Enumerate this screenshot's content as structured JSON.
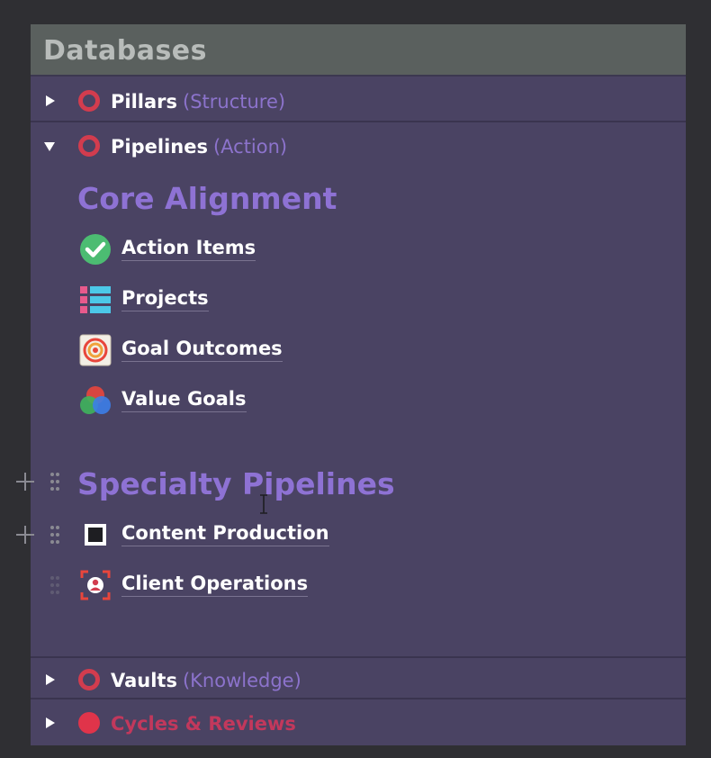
{
  "panel": {
    "title": "Databases"
  },
  "rows": {
    "pillars": {
      "label": "Pillars",
      "sub": "(Structure)",
      "state": "collapsed"
    },
    "pipelines": {
      "label": "Pipelines",
      "sub": "(Action)",
      "state": "expanded"
    },
    "vaults": {
      "label": "Vaults",
      "sub": "(Knowledge)",
      "state": "collapsed"
    },
    "cycles": {
      "label": "Cycles & Reviews",
      "state": "collapsed"
    }
  },
  "pipelines_content": {
    "core_heading": "Core Alignment",
    "core_items": [
      {
        "label": "Action Items",
        "icon": "check-circle-icon"
      },
      {
        "label": "Projects",
        "icon": "list-icon"
      },
      {
        "label": "Goal Outcomes",
        "icon": "target-icon"
      },
      {
        "label": "Value Goals",
        "icon": "color-circles-icon"
      }
    ],
    "specialty_heading": "Specialty Pipelines",
    "specialty_items": [
      {
        "label": "Content Production",
        "icon": "square-icon"
      },
      {
        "label": "Client Operations",
        "icon": "user-target-icon"
      }
    ]
  },
  "colors": {
    "panel_bg": "#4a4363",
    "header_bg": "#5a605e",
    "heading_purple": "#8e72d4",
    "ring_red": "#d23c4e",
    "cycles_red": "#c2385c"
  }
}
